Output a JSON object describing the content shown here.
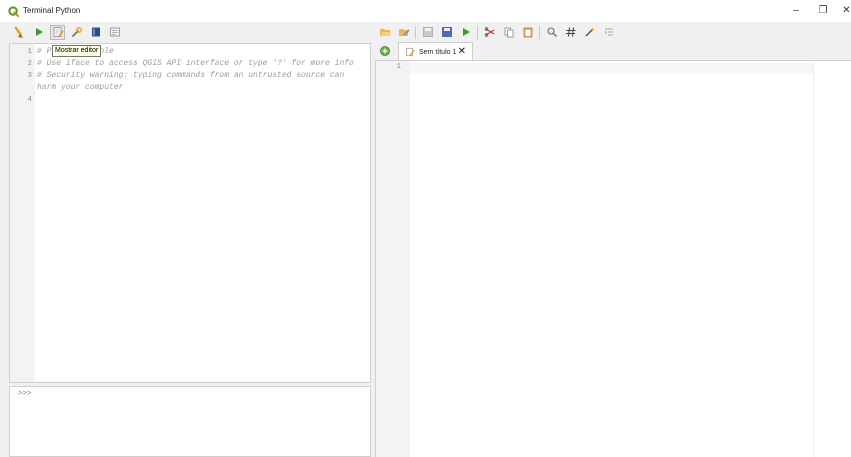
{
  "window": {
    "title": "Terminal Python",
    "minimize": "–",
    "restore": "❐",
    "close": "✕"
  },
  "console_toolbar": {
    "buttons": [
      "clear-console",
      "run-command",
      "show-editor",
      "options",
      "help",
      "settings"
    ]
  },
  "tooltip": {
    "text": "Mostrar editor"
  },
  "console": {
    "lines": [
      {
        "num": "1",
        "text": "# Python Console"
      },
      {
        "num": "2",
        "text": "# Use iface to access QGIS API interface or type '?' for more info"
      },
      {
        "num": "3",
        "text": "# Security warning: typing commands from an untrusted source can"
      },
      {
        "num": "",
        "text": "harm your computer"
      },
      {
        "num": "4",
        "text": ""
      }
    ],
    "prompt": ">>>"
  },
  "editor_toolbar": {
    "buttons": [
      "open-script",
      "open-in-external-editor",
      "save",
      "save-as",
      "run-script",
      "cut",
      "copy",
      "paste",
      "find",
      "toggle-comment",
      "object-inspector",
      "indent"
    ]
  },
  "editor": {
    "tab_label": "Sem título 1",
    "close_tab": "✕",
    "line_number": "1"
  },
  "colors": {
    "accent_green": "#3a9a2e",
    "qgis_green": "#589632",
    "tooltip_bg": "#ffffe1"
  }
}
